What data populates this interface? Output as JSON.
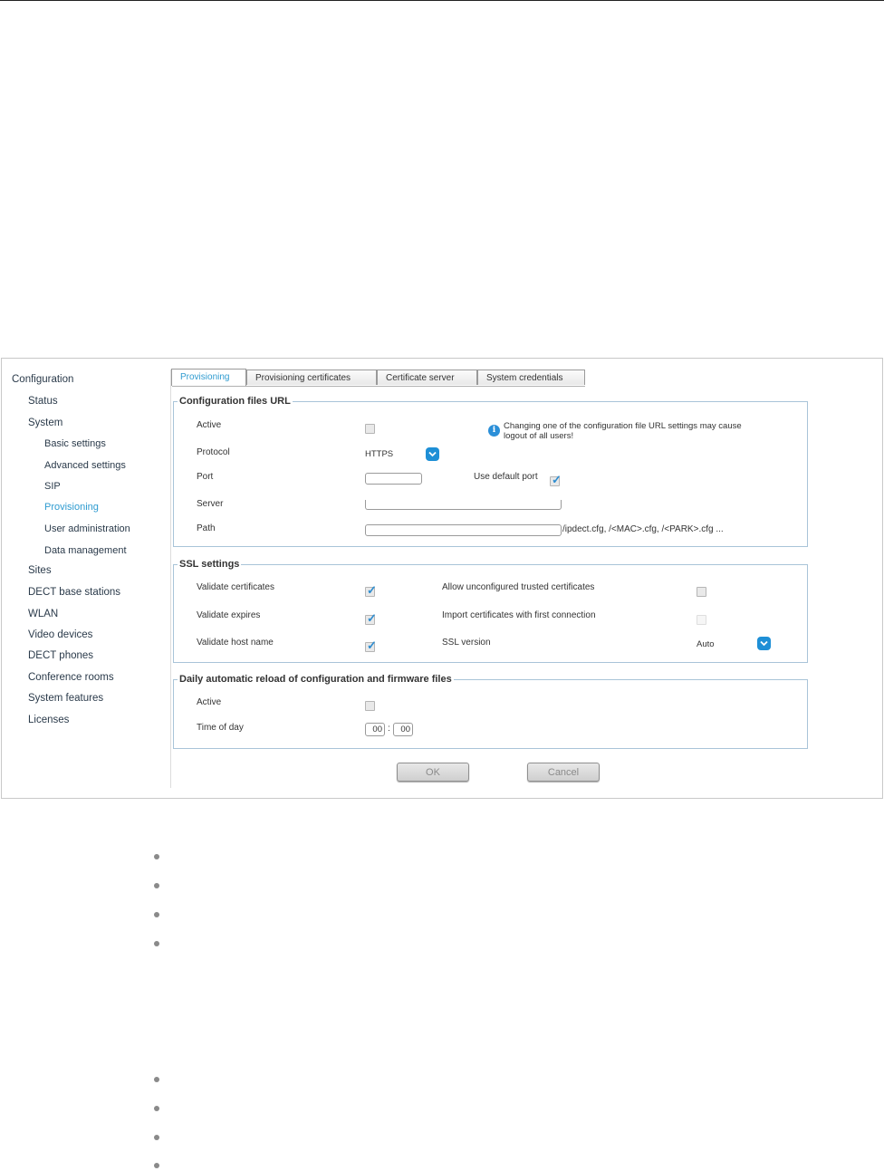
{
  "sidebar": {
    "items": [
      {
        "label": "Configuration",
        "level": 0
      },
      {
        "label": "Status",
        "level": 1
      },
      {
        "label": "System",
        "level": 1
      },
      {
        "label": "Basic settings",
        "level": 2
      },
      {
        "label": "Advanced settings",
        "level": 2
      },
      {
        "label": "SIP",
        "level": 2
      },
      {
        "label": "Provisioning",
        "level": 2,
        "active": true
      },
      {
        "label": "User administration",
        "level": 2
      },
      {
        "label": "Data management",
        "level": 2
      },
      {
        "label": "Sites",
        "level": 1
      },
      {
        "label": "DECT base stations",
        "level": 1
      },
      {
        "label": "WLAN",
        "level": 1
      },
      {
        "label": "Video devices",
        "level": 1
      },
      {
        "label": "DECT phones",
        "level": 1
      },
      {
        "label": "Conference rooms",
        "level": 1
      },
      {
        "label": "System features",
        "level": 1
      },
      {
        "label": "Licenses",
        "level": 1
      }
    ]
  },
  "tabs": [
    {
      "label": "Provisioning",
      "active": true
    },
    {
      "label": "Provisioning certificates"
    },
    {
      "label": "Certificate server"
    },
    {
      "label": "System credentials"
    }
  ],
  "config_url": {
    "legend": "Configuration files URL",
    "active_label": "Active",
    "active_checked": false,
    "info_text": "Changing one of the configuration file URL settings may cause logout of all users!",
    "protocol_label": "Protocol",
    "protocol_value": "HTTPS",
    "port_label": "Port",
    "port_value": "",
    "use_default_port_label": "Use default port",
    "use_default_port_checked": true,
    "server_label": "Server",
    "server_value": "",
    "path_label": "Path",
    "path_value": "",
    "path_suffix": "/ipdect.cfg, /<MAC>.cfg, /<PARK>.cfg ..."
  },
  "ssl": {
    "legend": "SSL settings",
    "validate_certificates_label": "Validate certificates",
    "validate_certificates_checked": true,
    "validate_expires_label": "Validate expires",
    "validate_expires_checked": true,
    "validate_host_name_label": "Validate host name",
    "validate_host_name_checked": true,
    "allow_unconfigured_label": "Allow unconfigured trusted certificates",
    "allow_unconfigured_checked": false,
    "import_first_label": "Import certificates with first connection",
    "import_first_checked": false,
    "ssl_version_label": "SSL version",
    "ssl_version_value": "Auto"
  },
  "reload": {
    "legend": "Daily automatic reload of configuration and firmware files",
    "active_label": "Active",
    "active_checked": false,
    "time_label": "Time of day",
    "hour": "00",
    "separator": ":",
    "minute": "00"
  },
  "buttons": {
    "ok": "OK",
    "cancel": "Cancel"
  },
  "colors": {
    "accent": "#2e9bd0",
    "chevron": "#1e8fd6",
    "checkmark": "#2e8dd0"
  }
}
